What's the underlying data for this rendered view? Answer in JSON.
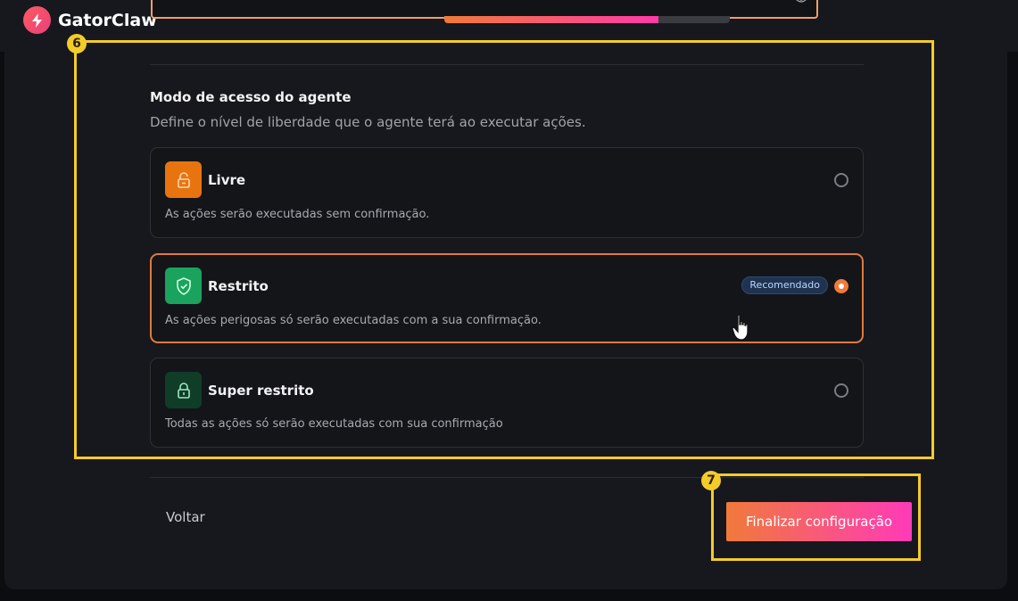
{
  "app": {
    "name": "GatorClaw"
  },
  "password_field": {
    "masked_value": "••••••••••••"
  },
  "progress": {
    "fraction": 0.75
  },
  "section": {
    "title": "Modo de acesso do agente",
    "description": "Define o nível de liberdade que o agente terá ao executar ações."
  },
  "options": [
    {
      "label": "Livre",
      "description": "As ações serão executadas sem confirmação.",
      "icon": "unlock-icon",
      "icon_color": "#e8740f",
      "selected": false
    },
    {
      "label": "Restrito",
      "description": "As ações perigosas só serão executadas com a sua confirmação.",
      "icon": "shield-check-icon",
      "icon_color": "#1aa35c",
      "badge": "Recomendado",
      "selected": true
    },
    {
      "label": "Super restrito",
      "description": "Todas as ações só serão executadas com sua confirmação",
      "icon": "lock-icon",
      "icon_color": "#0f3d28",
      "selected": false
    }
  ],
  "footer": {
    "back_label": "Voltar",
    "finish_label": "Finalizar configuração"
  },
  "annotations": {
    "marker_6": "6",
    "marker_7": "7",
    "highlight_color": "#f4cc2a"
  },
  "colors": {
    "accent_orange": "#f07a3a",
    "accent_pink": "#ff3ab8",
    "selected_border": "#e07a3c"
  }
}
